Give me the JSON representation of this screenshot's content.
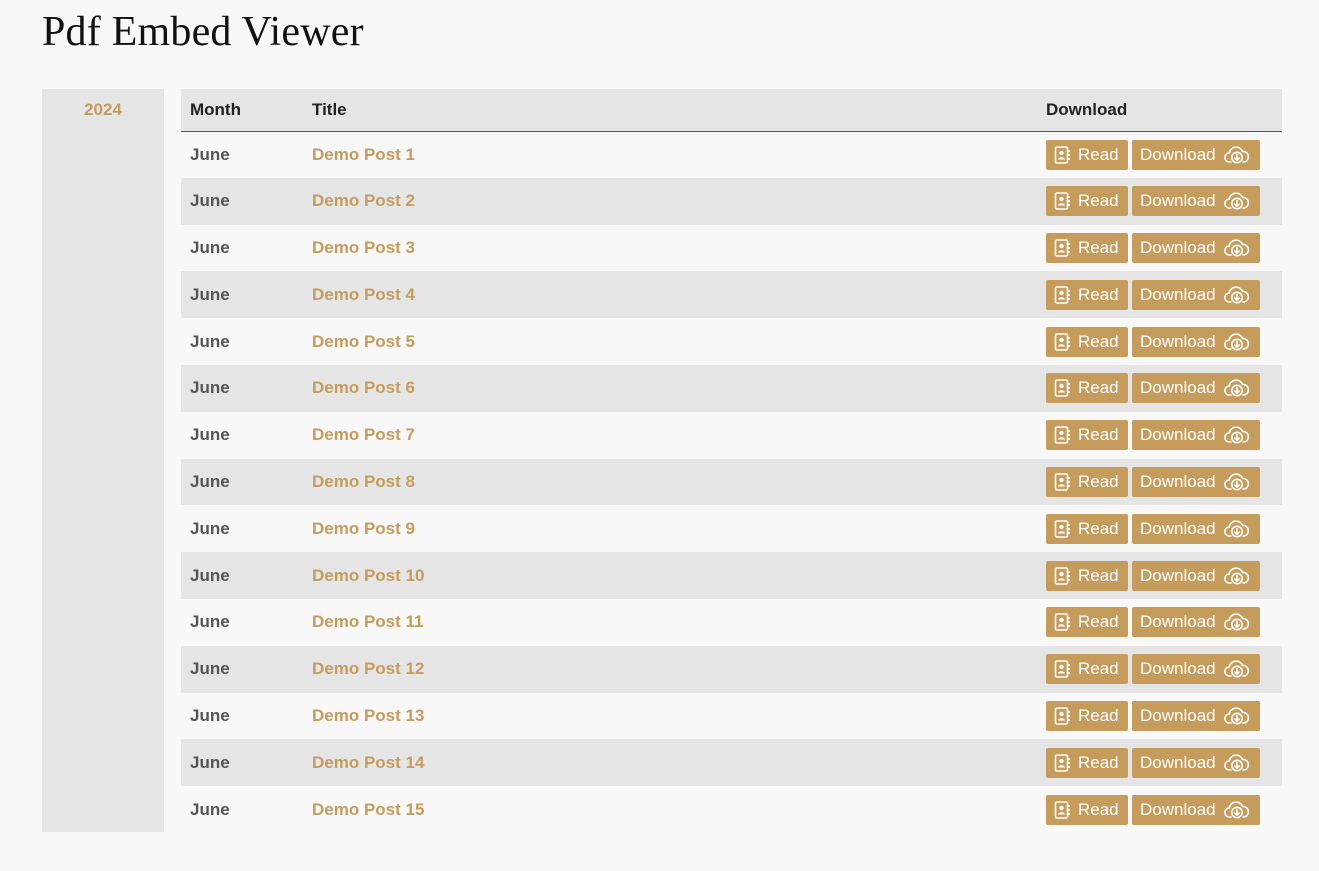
{
  "page": {
    "title": "Pdf Embed Viewer"
  },
  "sidebar": {
    "year": "2024"
  },
  "table": {
    "headers": {
      "month": "Month",
      "title": "Title",
      "download": "Download"
    },
    "read_label": "Read",
    "download_label": "Download",
    "rows": [
      {
        "month": "June",
        "title": "Demo Post 1"
      },
      {
        "month": "June",
        "title": "Demo Post 2"
      },
      {
        "month": "June",
        "title": "Demo Post 3"
      },
      {
        "month": "June",
        "title": "Demo Post 4"
      },
      {
        "month": "June",
        "title": "Demo Post 5"
      },
      {
        "month": "June",
        "title": "Demo Post 6"
      },
      {
        "month": "June",
        "title": "Demo Post 7"
      },
      {
        "month": "June",
        "title": "Demo Post 8"
      },
      {
        "month": "June",
        "title": "Demo Post 9"
      },
      {
        "month": "June",
        "title": "Demo Post 10"
      },
      {
        "month": "June",
        "title": "Demo Post 11"
      },
      {
        "month": "June",
        "title": "Demo Post 12"
      },
      {
        "month": "June",
        "title": "Demo Post 13"
      },
      {
        "month": "June",
        "title": "Demo Post 14"
      },
      {
        "month": "June",
        "title": "Demo Post 15"
      }
    ]
  },
  "colors": {
    "accent": "#c69c5d",
    "stripe": "#e5e5e5",
    "background": "#f8f8f8"
  },
  "icons": {
    "read": "contact-book-icon",
    "download": "cloud-download-icon"
  }
}
